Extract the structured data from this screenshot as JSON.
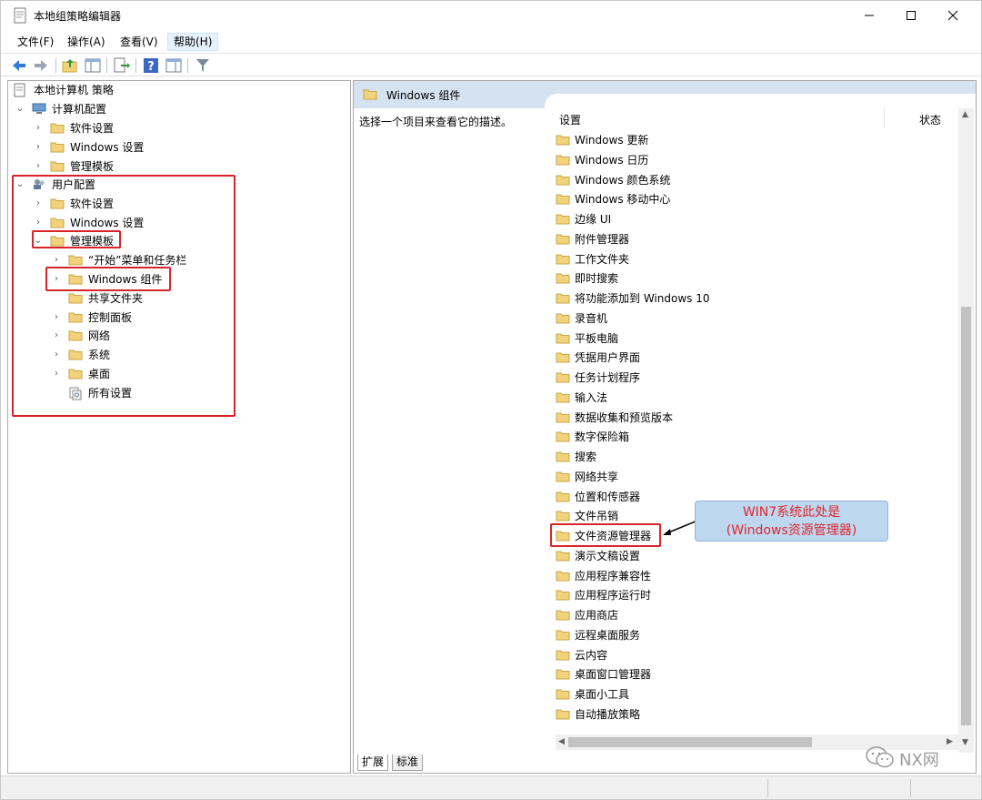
{
  "window": {
    "title": "本地组策略编辑器",
    "controls": {
      "minimize": "minimize-icon",
      "maximize": "maximize-icon",
      "close": "close-icon"
    }
  },
  "menu": [
    {
      "label": "文件(F)"
    },
    {
      "label": "操作(A)"
    },
    {
      "label": "查看(V)"
    },
    {
      "label": "帮助(H)"
    }
  ],
  "toolbar": [
    "back-arrow-icon",
    "forward-arrow-icon",
    "up-folder-icon",
    "show-hide-tree-icon",
    "export-list-icon",
    "help-icon",
    "show-hide-action-pane-icon",
    "filter-icon"
  ],
  "tree": {
    "root": "本地计算机 策略",
    "computer_config": "计算机配置",
    "computer_children": [
      "软件设置",
      "Windows 设置",
      "管理模板"
    ],
    "user_config": "用户配置",
    "user_children": [
      "软件设置",
      "Windows 设置",
      "管理模板"
    ],
    "admin_children": [
      "“开始”菜单和任务栏",
      "Windows 组件",
      "共享文件夹",
      "控制面板",
      "网络",
      "系统",
      "桌面",
      "所有设置"
    ]
  },
  "right": {
    "header_title": "Windows 组件",
    "description": "选择一个项目来查看它的描述。",
    "col_setting": "设置",
    "col_state": "状态",
    "items": [
      "Windows 更新",
      "Windows 日历",
      "Windows 颜色系统",
      "Windows 移动中心",
      "边缘 UI",
      "附件管理器",
      "工作文件夹",
      "即时搜索",
      "将功能添加到 Windows 10",
      "录音机",
      "平板电脑",
      "凭据用户界面",
      "任务计划程序",
      "输入法",
      "数据收集和预览版本",
      "数字保险箱",
      "搜索",
      "网络共享",
      "位置和传感器",
      "文件吊销",
      "文件资源管理器",
      "演示文稿设置",
      "应用程序兼容性",
      "应用程序运行时",
      "应用商店",
      "远程桌面服务",
      "云内容",
      "桌面窗口管理器",
      "桌面小工具",
      "自动播放策略"
    ],
    "tabs": [
      "扩展",
      "标准"
    ]
  },
  "annotation": {
    "line1": "WIN7系统此处是",
    "line2": "(Windows资源管理器)",
    "color": "#d9232b"
  },
  "watermark": "NX网",
  "colors": {
    "folder": "#f2d27a",
    "header_bg": "#d5e2ef",
    "callout_bg": "#bdd7ee"
  }
}
